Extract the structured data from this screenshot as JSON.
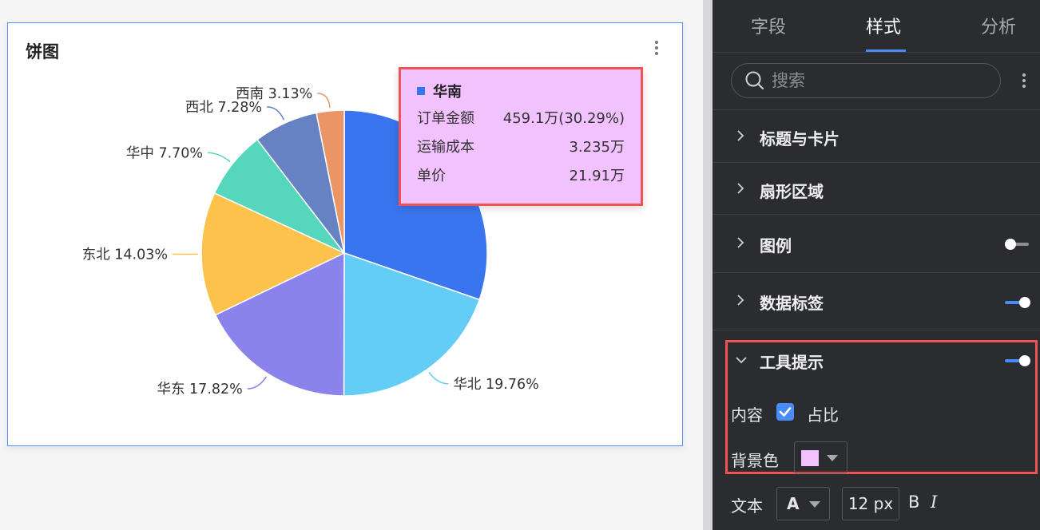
{
  "card": {
    "title": "饼图"
  },
  "chart_data": {
    "type": "pie",
    "title": "饼图",
    "categories": [
      "华南",
      "华北",
      "华东",
      "东北",
      "华中",
      "西北",
      "西南"
    ],
    "values": [
      30.29,
      19.76,
      17.82,
      14.03,
      7.7,
      7.28,
      3.13
    ],
    "labels": [
      "华南 30.29%",
      "华北 19.76%",
      "华东 17.82%",
      "东北 14.03%",
      "华中 7.70%",
      "西北 7.28%",
      "西南 3.13%"
    ],
    "colors": [
      "#3a75f0",
      "#64cdf5",
      "#8a83eb",
      "#fcc24c",
      "#56d6bd",
      "#6682c3",
      "#eb9566"
    ],
    "legend": "none"
  },
  "tooltip": {
    "title": "华南",
    "color": "#3a75f0",
    "rows": [
      {
        "label": "订单金额",
        "value": "459.1万(30.29%)"
      },
      {
        "label": "运输成本",
        "value": "3.235万"
      },
      {
        "label": "单价",
        "value": "21.91万"
      }
    ]
  },
  "panel": {
    "tabs": [
      "字段",
      "样式",
      "分析"
    ],
    "active_tab": "样式",
    "search_placeholder": "搜索",
    "sections": [
      {
        "label": "标题与卡片"
      },
      {
        "label": "扇形区域"
      },
      {
        "label": "图例",
        "toggle": false
      },
      {
        "label": "数据标签",
        "toggle": true
      },
      {
        "label": "工具提示",
        "toggle": true,
        "expanded": true
      }
    ],
    "tooltip_settings": {
      "content_label": "内容",
      "checkbox_label": "占比",
      "checkbox_checked": true,
      "bg_label": "背景色",
      "bg_color": "#f2c1ff"
    },
    "text_settings": {
      "label": "文本",
      "font_glyph": "A",
      "size": "12 px",
      "bold": "B",
      "italic": "I"
    }
  }
}
